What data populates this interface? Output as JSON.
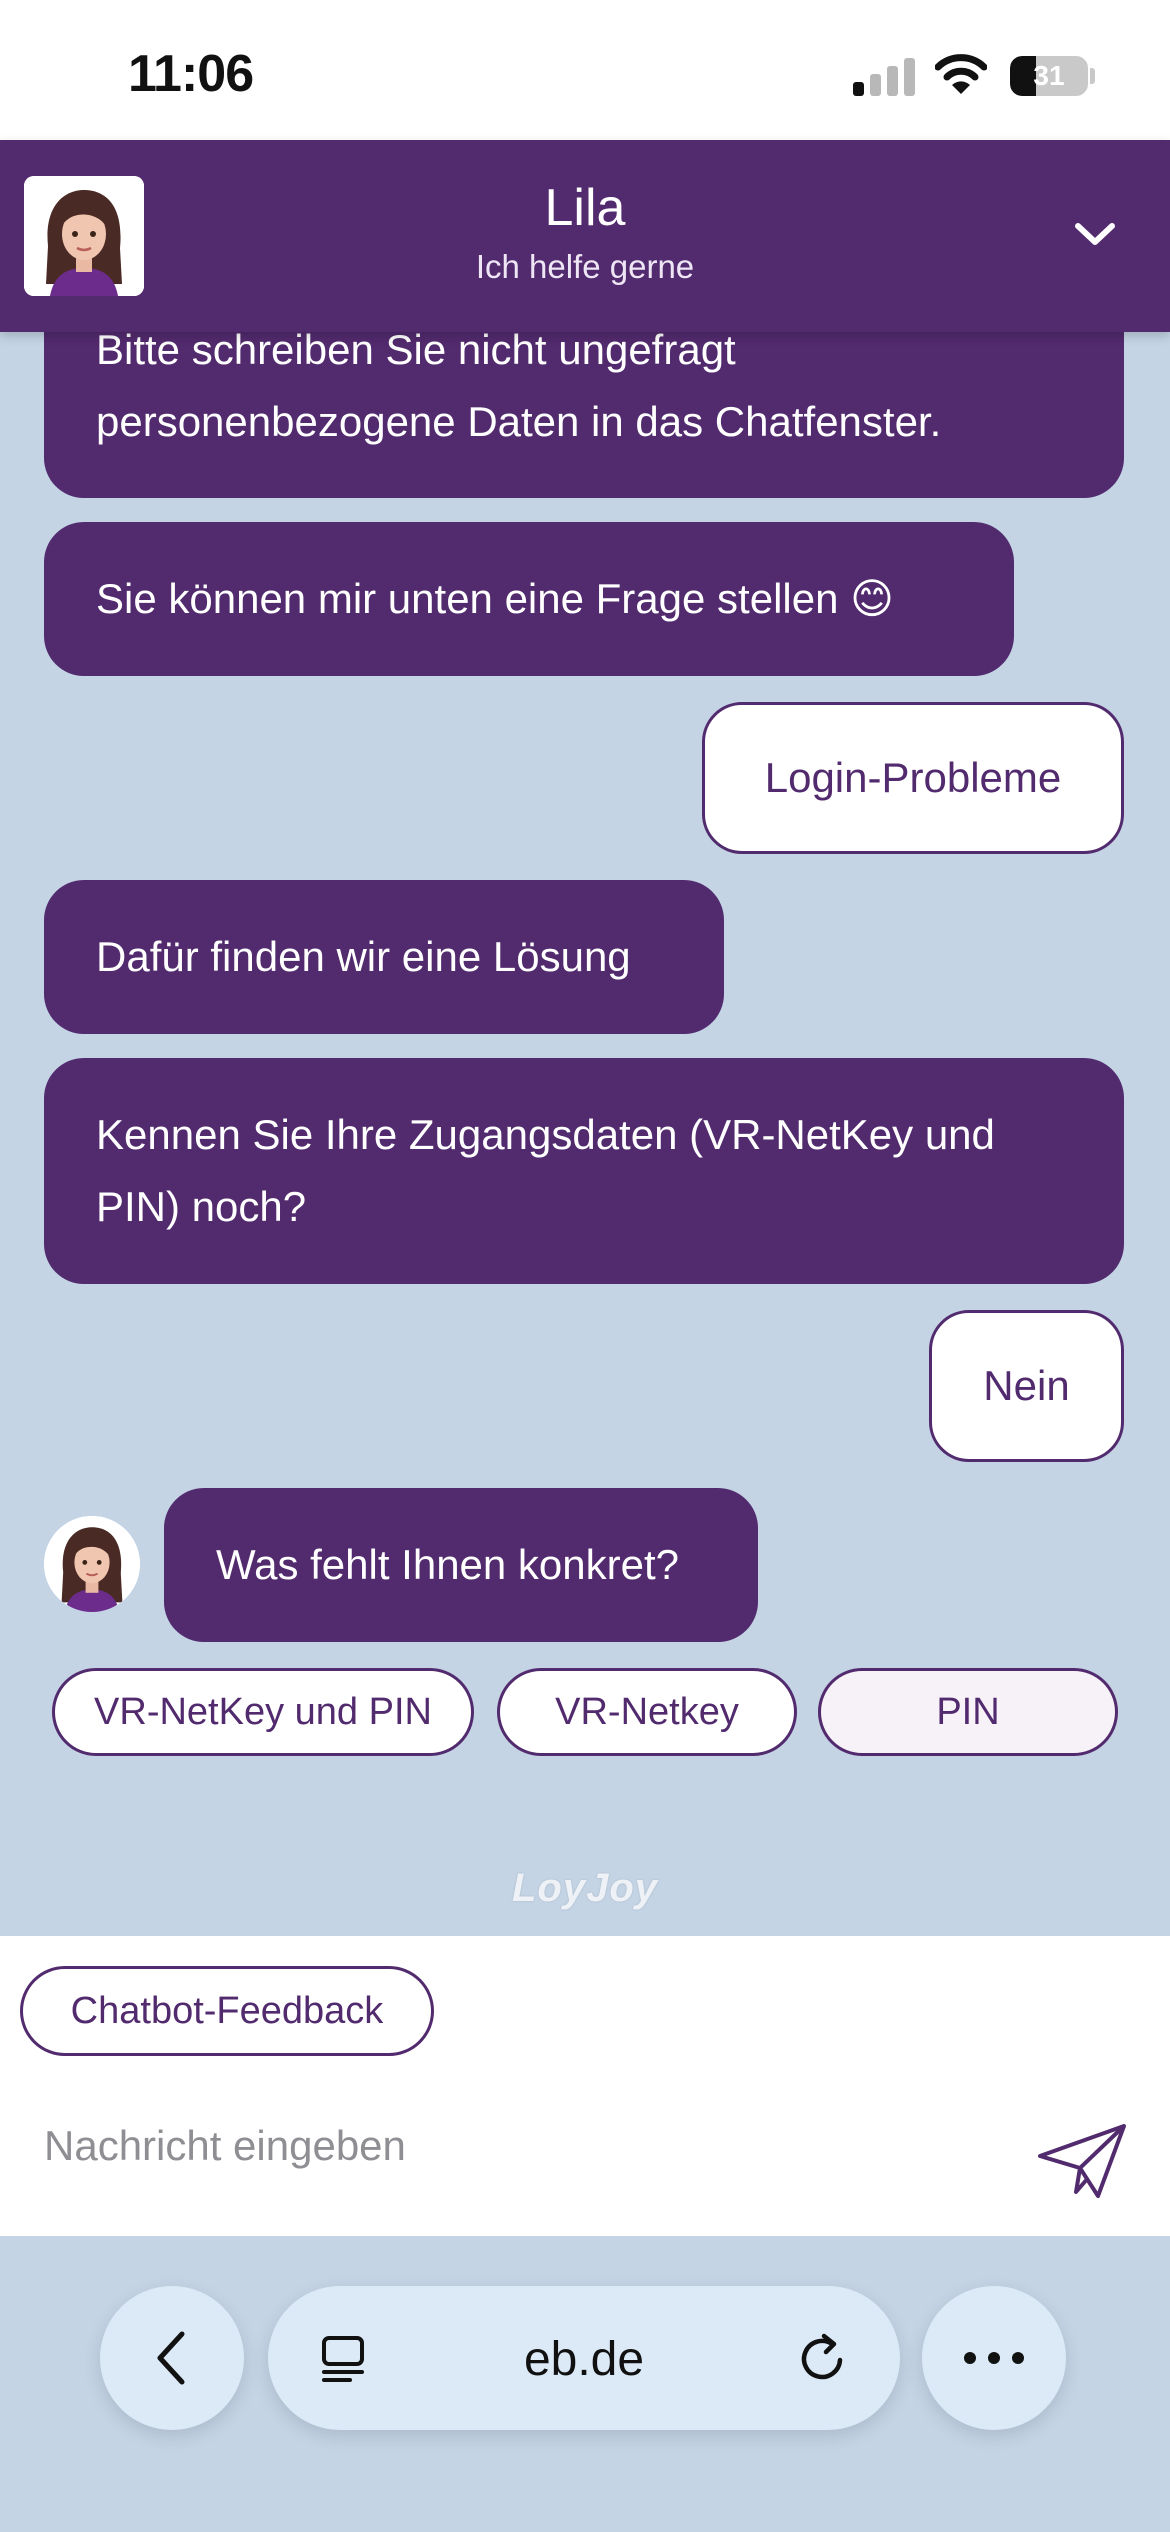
{
  "status_bar": {
    "time": "11:06",
    "battery": "31"
  },
  "header": {
    "name": "Lila",
    "subtitle": "Ich helfe gerne"
  },
  "messages": [
    {
      "from": "bot",
      "text": "Bitte schreiben Sie nicht ungefragt personenbezogene Daten in das Chatfenster."
    },
    {
      "from": "bot",
      "text": "Sie können mir unten eine Frage stellen 😊"
    },
    {
      "from": "user",
      "text": "Login-Probleme"
    },
    {
      "from": "bot",
      "text": "Dafür finden wir eine Lösung"
    },
    {
      "from": "bot",
      "text": "Kennen Sie Ihre Zugangsdaten (VR-NetKey und PIN) noch?"
    },
    {
      "from": "user",
      "text": "Nein"
    },
    {
      "from": "bot",
      "text": "Was fehlt Ihnen konkret?"
    }
  ],
  "quick_replies": [
    "VR-NetKey und PIN",
    "VR-Netkey",
    "PIN"
  ],
  "powered_by": "LoyJoy",
  "input": {
    "feedback_label": "Chatbot-Feedback",
    "placeholder": "Nachricht eingeben"
  },
  "browser": {
    "url": "eb.de"
  },
  "colors": {
    "brand_purple": "#522a6e",
    "chat_background": "#c4d4e5",
    "toolbar_button": "#dceaf8"
  },
  "icons": [
    "cellular-signal-icon",
    "wifi-icon",
    "battery-icon",
    "chevron-down-icon",
    "send-icon",
    "back-icon",
    "tabs-icon",
    "reload-icon",
    "more-icon"
  ]
}
